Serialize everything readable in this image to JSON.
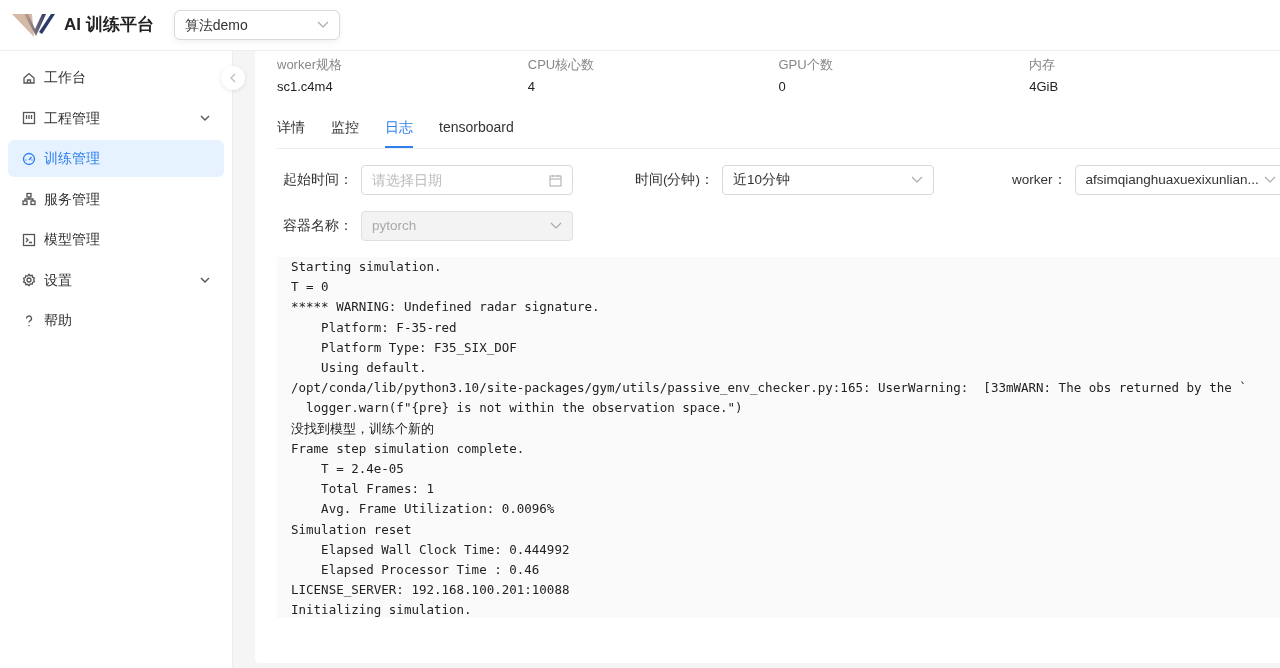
{
  "header": {
    "app_title": "AI 训练平台",
    "project_select": {
      "value": "算法demo"
    }
  },
  "sidebar": {
    "items": [
      {
        "label": "工作台",
        "selected": false,
        "expandable": false
      },
      {
        "label": "工程管理",
        "selected": false,
        "expandable": true
      },
      {
        "label": "训练管理",
        "selected": true,
        "expandable": false
      },
      {
        "label": "服务管理",
        "selected": false,
        "expandable": false
      },
      {
        "label": "模型管理",
        "selected": false,
        "expandable": false
      },
      {
        "label": "设置",
        "selected": false,
        "expandable": true
      },
      {
        "label": "帮助",
        "selected": false,
        "expandable": false
      }
    ]
  },
  "specs": [
    {
      "label": "worker规格",
      "value": "sc1.c4m4"
    },
    {
      "label": "CPU核心数",
      "value": "4"
    },
    {
      "label": "GPU个数",
      "value": "0"
    },
    {
      "label": "内存",
      "value": "4GiB"
    }
  ],
  "tabs": [
    {
      "label": "详情",
      "selected": false
    },
    {
      "label": "监控",
      "selected": false
    },
    {
      "label": "日志",
      "selected": true
    },
    {
      "label": "tensorboard",
      "selected": false
    }
  ],
  "filters": [
    {
      "label": "起始时间：",
      "kind": "date",
      "placeholder": "请选择日期",
      "disabled": false
    },
    {
      "label": "时间(分钟)：",
      "kind": "select",
      "value": "近10分钟",
      "disabled": false
    },
    {
      "label": "worker：",
      "kind": "select",
      "value": "afsimqianghuaxuexixunlian...",
      "disabled": false
    },
    {
      "label": "容器名称：",
      "kind": "select",
      "value": "pytorch",
      "disabled": true
    }
  ],
  "log_lines": [
    "Starting simulation.",
    "T = 0",
    "***** WARNING: Undefined radar signature.",
    "    Platform: F-35-red",
    "    Platform Type: F35_SIX_DOF",
    "    Using default.",
    "/opt/conda/lib/python3.10/site-packages/gym/utils/passive_env_checker.py:165: UserWarning:  [33mWARN: The obs returned by the `",
    "  logger.warn(f\"{pre} is not within the observation space.\")",
    "没找到模型，训练个新的",
    "Frame step simulation complete.",
    "    T = 2.4e-05",
    "    Total Frames: 1",
    "    Avg. Frame Utilization: 0.0096%",
    "Simulation reset",
    "    Elapsed Wall Clock Time: 0.444992",
    "    Elapsed Processor Time : 0.46",
    "LICENSE_SERVER: 192.168.100.201:10088",
    "Initializing simulation."
  ]
}
